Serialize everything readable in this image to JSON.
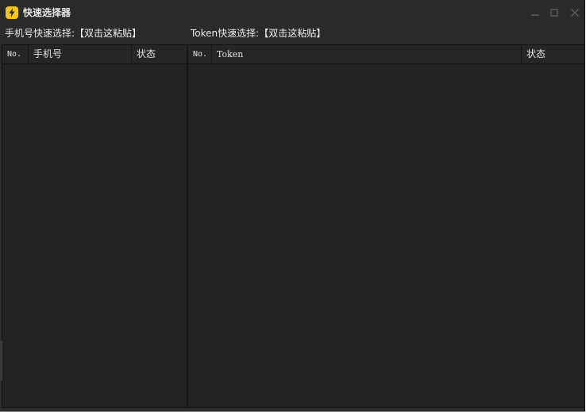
{
  "window": {
    "title": "快速选择器",
    "icon": "lightning-icon",
    "colors": {
      "background": "#2b2b2b",
      "panel": "#222222",
      "icon_accent": "#f5c518",
      "text": "#e6e6e6"
    }
  },
  "quick_select": {
    "phone_label": "手机号快速选择:",
    "phone_action": "【双击这粘贴】",
    "token_label": "Token快速选择:",
    "token_action": "【双击这粘贴】"
  },
  "phone_table": {
    "columns": [
      "No.",
      "手机号",
      "状态"
    ],
    "rows": []
  },
  "token_table": {
    "columns": [
      "No.",
      "Token",
      "状态"
    ],
    "rows": []
  }
}
